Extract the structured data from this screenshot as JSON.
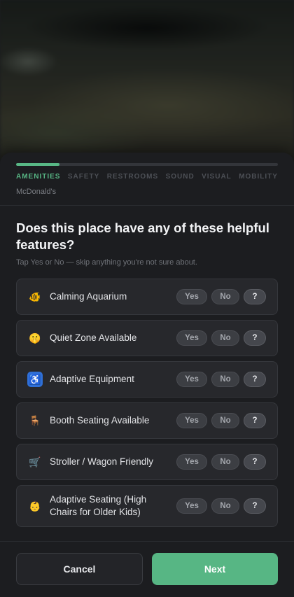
{
  "colors": {
    "accent": "#58b785",
    "sheet": "#1c1d20",
    "row_bg": "#27282c"
  },
  "progress": {
    "value": 0.167
  },
  "steps": [
    "AMENITIES",
    "SAFETY",
    "RESTROOMS",
    "SOUND",
    "VISUAL",
    "MOBILITY"
  ],
  "place_name": "McDonald's",
  "question": "Does this place have any of these helpful features?",
  "hint": "Tap Yes or No — skip anything you're not sure about.",
  "answer_labels": {
    "yes": "Yes",
    "no": "No",
    "unsure": "?"
  },
  "features": [
    {
      "icon": "fish-icon",
      "glyph": "🐠",
      "label": "Calming Aquarium"
    },
    {
      "icon": "shushing-face-icon",
      "glyph": "🤫",
      "label": "Quiet Zone Available"
    },
    {
      "icon": "wheelchair-icon",
      "glyph": "♿",
      "label": "Adaptive Equipment"
    },
    {
      "icon": "chair-icon",
      "glyph": "🪑",
      "label": "Booth Seating Available"
    },
    {
      "icon": "shopping-cart-icon",
      "glyph": "🛒",
      "label": "Stroller / Wagon Friendly"
    },
    {
      "icon": "baby-icon",
      "glyph": "👶",
      "label": "Adaptive Seating (High Chairs for Older Kids)"
    }
  ],
  "footer": {
    "cancel_label": "Cancel",
    "next_label": "Next"
  }
}
